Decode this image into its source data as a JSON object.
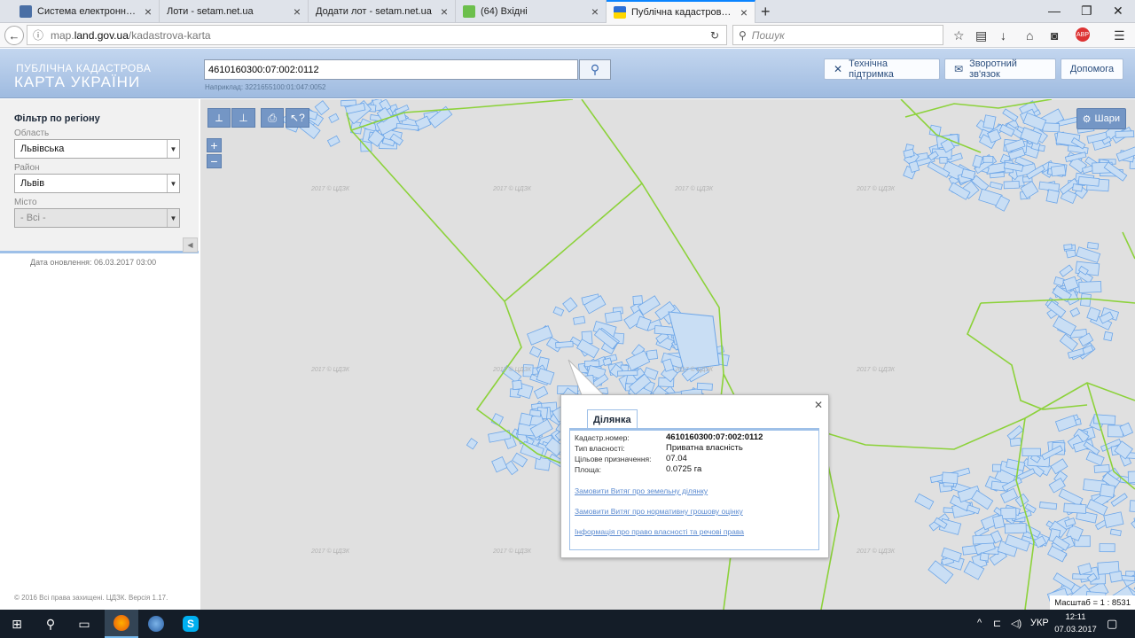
{
  "browser": {
    "tabs": [
      {
        "title": "Система електронної по...",
        "favicon_color": "#4a6fa5",
        "active": false
      },
      {
        "title": "Лоти - setam.net.ua",
        "favicon_color": "#ffffff",
        "active": false
      },
      {
        "title": "Додати лот - setam.net.ua",
        "favicon_color": "#ffffff",
        "active": false
      },
      {
        "title": "(64) Вхідні",
        "favicon_color": "#6cbf4c",
        "active": false
      },
      {
        "title": "Публічна кадастрова кар...",
        "favicon_color": "#ffd700",
        "active": true
      }
    ],
    "new_tab": "+",
    "url_prefix": "map.",
    "url_domain": "land.gov.ua",
    "url_path": "/kadastrova-karta",
    "search_placeholder": "Пошук"
  },
  "header": {
    "logo_line1": "ПУБЛІЧНА КАДАСТРОВА",
    "logo_line2": "КАРТА УКРАЇНИ",
    "cadastral_value": "4610160300:07:002:0112",
    "example_text": "Наприклад: 3221655100:01:047:0052",
    "support_label": "Технічна підтримка",
    "feedback_label": "Зворотний зв'язок",
    "help_label": "Допомога"
  },
  "sidebar": {
    "filter_title": "Фільтр по регіону",
    "oblast_label": "Область",
    "oblast_value": "Львівська",
    "rayon_label": "Район",
    "rayon_value": "Львів",
    "city_label": "Місто",
    "city_value": "- Всі -",
    "update_text": "Дата оновлення: 06.03.2017 03:00",
    "copyright": "© 2016 Всі права захищені. ЦДЗК. Версія 1.17."
  },
  "map": {
    "layers_label": "Шари",
    "watermark": "2017 © ЦДЗК",
    "scale_text": "Масштаб = 1 : 8531",
    "zoom_in": "+",
    "zoom_out": "−"
  },
  "popup": {
    "tab_title": "Ділянка",
    "rows": [
      {
        "label": "Кадастр.номер:",
        "value": "4610160300:07:002:0112",
        "bold": true
      },
      {
        "label": "Тип власності:",
        "value": "Приватна власність",
        "bold": false
      },
      {
        "label": "Цільове призначення:",
        "value": "07.04",
        "bold": false
      },
      {
        "label": "Площа:",
        "value": "0.0725 га",
        "bold": false
      }
    ],
    "links": [
      "Замовити Витяг про земельну ділянку",
      "Замовити Витяг про нормативну грошову оцінку",
      "Інформація про право власності та речові права"
    ]
  },
  "taskbar": {
    "lang": "УКР",
    "time": "12:11",
    "date": "07.03.2017"
  },
  "colors": {
    "parcel_fill": "#c9def4",
    "parcel_stroke": "#6da6e8",
    "boundary": "#8cd23a"
  }
}
